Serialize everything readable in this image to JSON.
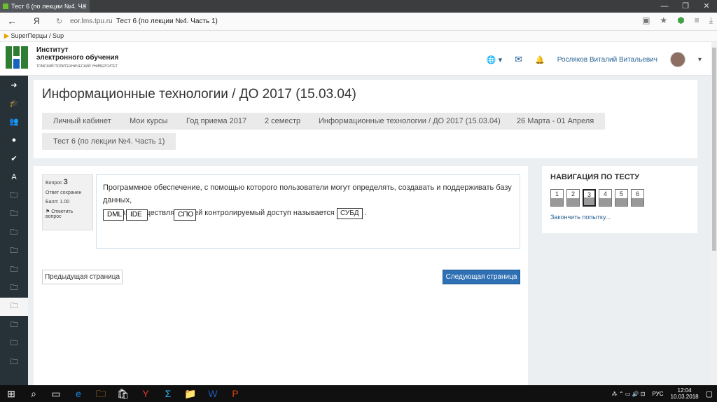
{
  "browser": {
    "tab_title": "Тест 6 (по лекции №4. Ча",
    "tab_close": "×",
    "win_minimize": "—",
    "win_maximize": "❐",
    "win_close": "✕",
    "back_glyph": "←",
    "yandex_glyph": "Я",
    "reload_glyph": "↻",
    "host": "eor.lms.tpu.ru",
    "page_title": "Тест 6 (по лекции №4. Часть 1)",
    "bookmark": "SuperПерцы / Sup",
    "bookmark_glyph": "▶"
  },
  "site": {
    "logo_line1": "Институт",
    "logo_line2": "электронного обучения",
    "logo_sub": "ТОМСКИЙ ПОЛИТЕХНИЧЕСКИЙ УНИВЕРСИТЕТ",
    "user_name": "Росляков Виталий Витальевич",
    "globe_glyph": "🌐 ▾",
    "mail_glyph": "✉",
    "bell_glyph": "🔔",
    "user_menu_glyph": "▾"
  },
  "sidebar": {
    "items": [
      "➜",
      "🎓",
      "👥",
      "●",
      "✔",
      "A",
      "🗀",
      "🗀",
      "🗀",
      "🗀",
      "🗀",
      "🗀",
      "🗀",
      "🗀",
      "🗀",
      "🗀"
    ]
  },
  "page": {
    "title": "Информационные технологии / ДО 2017 (15.03.04)",
    "breadcrumbs": [
      "Личный кабинет",
      "Мои курсы",
      "Год приема 2017",
      "2 семестр",
      "Информационные технологии / ДО 2017 (15.03.04)",
      "26 Марта - 01 Апреля",
      "Тест 6 (по лекции №4. Часть 1)"
    ]
  },
  "question": {
    "label": "Вопрос",
    "number": "3",
    "status": "Ответ сохранен",
    "score": "Балл: 1.00",
    "flag_glyph": "⚑",
    "flag_label": "Отметить вопрос",
    "text_part1": "Программное обеспечение, с помощью которого пользователи могут определять, создавать и поддерживать базу данных,",
    "text_part2": "а также осуществлять к ней контролируемый доступ называется",
    "dropped_answer": "СУБД",
    "text_end": ".",
    "choices": [
      "DML",
      "IDE",
      "СПО"
    ]
  },
  "buttons": {
    "prev": "Предыдущая страница",
    "next": "Следующая страница"
  },
  "quiz_nav": {
    "title": "НАВИГАЦИЯ ПО ТЕСТУ",
    "questions": [
      "1",
      "2",
      "3",
      "4",
      "5",
      "6"
    ],
    "current": "3",
    "finish": "Закончить попытку..."
  },
  "taskbar": {
    "icons": [
      "⊞",
      "⌕",
      "▭",
      "e",
      "🗀",
      "🛍",
      "Y",
      "Σ",
      "📁",
      "W",
      "P"
    ],
    "lang": "РУС",
    "time": "12:04",
    "date": "10.03.2018",
    "tray_glyphs": "⁂ ⌃ ▭ 🔊 ⊡"
  }
}
